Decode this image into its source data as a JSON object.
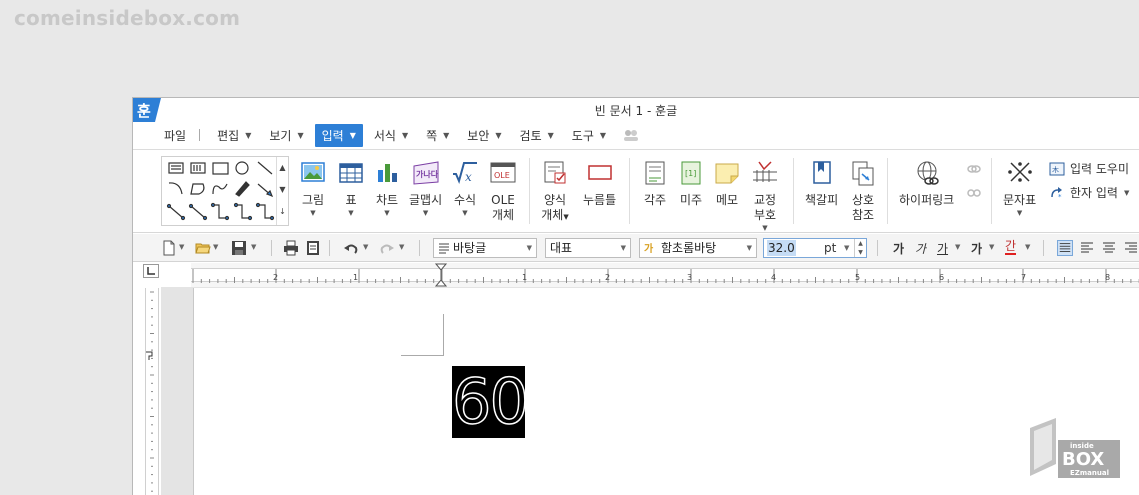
{
  "watermark": "comeinsidebox.com",
  "window": {
    "app_logo_glyph": "훈",
    "title": "빈 문서 1 - 훈글"
  },
  "menu": {
    "file": "파일",
    "items": [
      {
        "label": "편집",
        "active": false
      },
      {
        "label": "보기",
        "active": false
      },
      {
        "label": "입력",
        "active": true
      },
      {
        "label": "서식",
        "active": false
      },
      {
        "label": "쪽",
        "active": false
      },
      {
        "label": "보안",
        "active": false
      },
      {
        "label": "검토",
        "active": false
      },
      {
        "label": "도구",
        "active": false
      }
    ]
  },
  "ribbon": {
    "buttons": [
      {
        "label": "그림",
        "icon": "picture-icon",
        "dropdown": true
      },
      {
        "label": "표",
        "icon": "table-icon",
        "dropdown": true
      },
      {
        "label": "차트",
        "icon": "chart-icon",
        "dropdown": true
      },
      {
        "label": "글맵시",
        "icon": "wordart-icon",
        "dropdown": true
      },
      {
        "label": "수식",
        "icon": "formula-icon",
        "dropdown": true
      },
      {
        "label": "OLE",
        "label2": "개체",
        "icon": "ole-icon",
        "dropdown": false
      },
      {
        "label": "양식",
        "label2": "개체",
        "icon": "form-icon",
        "dropdown": true
      },
      {
        "label": "누름틀",
        "icon": "field-icon",
        "dropdown": false
      },
      {
        "label": "각주",
        "icon": "footnote-icon",
        "dropdown": false
      },
      {
        "label": "미주",
        "icon": "endnote-icon",
        "dropdown": false
      },
      {
        "label": "메모",
        "icon": "memo-icon",
        "dropdown": false
      },
      {
        "label": "교정",
        "label2": "부호",
        "icon": "proofmark-icon",
        "dropdown": true
      },
      {
        "label": "책갈피",
        "icon": "bookmark-icon",
        "dropdown": false
      },
      {
        "label": "상호",
        "label2": "참조",
        "icon": "crossref-icon",
        "dropdown": false
      },
      {
        "label": "하이퍼링크",
        "icon": "hyperlink-icon",
        "dropdown": false
      },
      {
        "label": "문자표",
        "icon": "symbol-icon",
        "dropdown": true
      }
    ],
    "input_helper": "입력 도우미",
    "hanja_input": "한자 입력",
    "ole_icon_text": "OLE",
    "wordart_icon_text": "가나다"
  },
  "format_bar": {
    "style": "바탕글",
    "language": "대표",
    "font": "함초롬바탕",
    "size_value": "32.0",
    "size_unit": "pt",
    "char_bold": "가",
    "char_italic": "가",
    "char_underline": "가",
    "char_strike": "가",
    "char_color": "간"
  },
  "ruler": {
    "labels": [
      "2",
      "1",
      "1",
      "2",
      "3",
      "4",
      "5",
      "6",
      "7",
      "8"
    ]
  },
  "document": {
    "image_text": "60"
  },
  "box_logo": {
    "line1": "inside",
    "line2": "BOX",
    "line3": "EZmanual"
  }
}
